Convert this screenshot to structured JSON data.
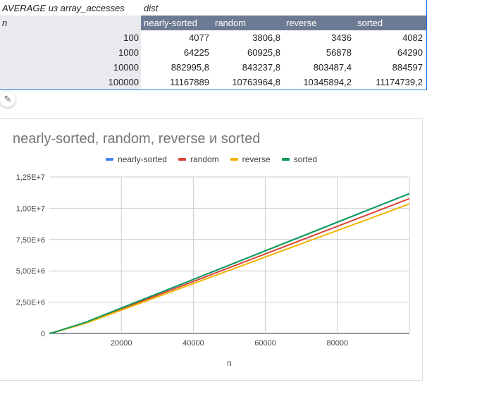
{
  "pivot": {
    "title": "AVERAGE из array_accesses",
    "dist_label": "dist",
    "row_header": "n",
    "columns": [
      "nearly-sorted",
      "random",
      "reverse",
      "sorted"
    ],
    "rows": [
      {
        "n": "100",
        "values": [
          "4077",
          "3806,8",
          "3436",
          "4082"
        ]
      },
      {
        "n": "1000",
        "values": [
          "64225",
          "60925,8",
          "56878",
          "64290"
        ]
      },
      {
        "n": "10000",
        "values": [
          "882995,8",
          "843237,8",
          "803487,4",
          "884597"
        ]
      },
      {
        "n": "100000",
        "values": [
          "11167889",
          "10763964,8",
          "10345894,2",
          "11174739,2"
        ]
      }
    ]
  },
  "chart_data": {
    "type": "line",
    "title": "nearly-sorted, random, reverse и sorted",
    "xlabel": "n",
    "ylabel": "",
    "x": [
      100,
      1000,
      10000,
      100000
    ],
    "xlim": [
      0,
      100000
    ],
    "ylim": [
      0,
      12500000
    ],
    "x_ticks": [
      20000,
      40000,
      60000,
      80000
    ],
    "x_tick_labels": [
      "20000",
      "40000",
      "60000",
      "80000"
    ],
    "y_ticks": [
      0,
      2500000,
      5000000,
      7500000,
      10000000,
      12500000
    ],
    "y_tick_labels": [
      "0",
      "2,50E+6",
      "5,00E+6",
      "7,50E+6",
      "1,00E+7",
      "1,25E+7"
    ],
    "grid": true,
    "legend_position": "top",
    "series": [
      {
        "name": "nearly-sorted",
        "color": "#4285f4",
        "values": [
          4077,
          64225,
          882995.8,
          11167889
        ]
      },
      {
        "name": "random",
        "color": "#db4437",
        "values": [
          3806.8,
          60925.8,
          843237.8,
          10763964.8
        ]
      },
      {
        "name": "reverse",
        "color": "#f4b400",
        "values": [
          3436,
          56878,
          803487.4,
          10345894.2
        ]
      },
      {
        "name": "sorted",
        "color": "#0f9d58",
        "values": [
          4082,
          64290,
          884597,
          11174739.2
        ]
      }
    ]
  }
}
